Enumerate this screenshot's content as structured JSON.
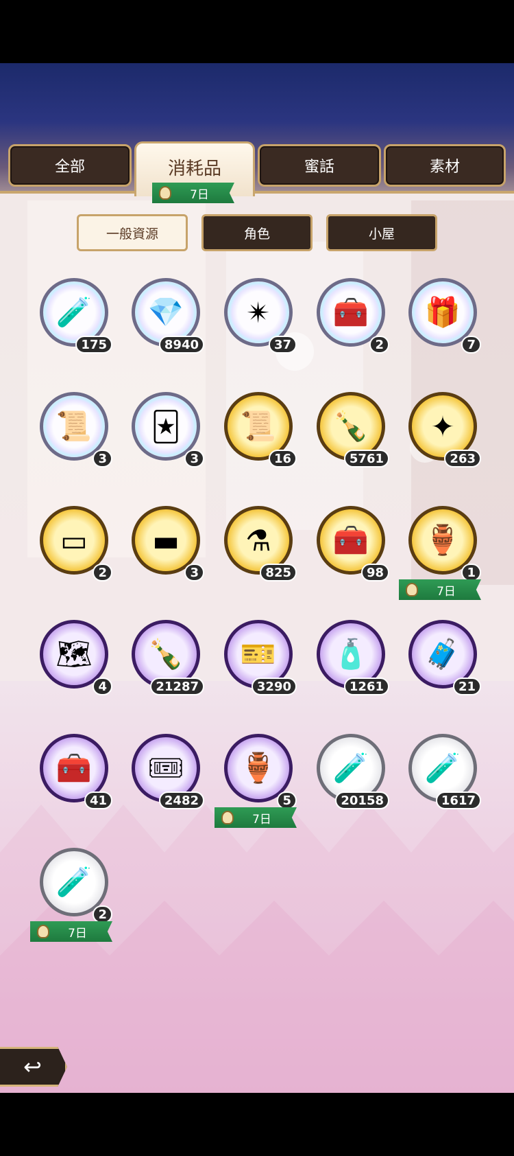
{
  "tabs": [
    {
      "label": "全部"
    },
    {
      "label": "消耗品"
    },
    {
      "label": "蜜話"
    },
    {
      "label": "素材"
    }
  ],
  "tab_timer": "7日",
  "subtabs": [
    {
      "label": "一般資源"
    },
    {
      "label": "角色"
    },
    {
      "label": "小屋"
    }
  ],
  "items": [
    {
      "count": "175",
      "icon": "green-potion-icon",
      "frame": "rainbow"
    },
    {
      "count": "8940",
      "icon": "crystal-icon",
      "frame": "rainbow"
    },
    {
      "count": "37",
      "icon": "purple-star-icon",
      "frame": "rainbow"
    },
    {
      "count": "2",
      "icon": "red-chest-icon",
      "frame": "rainbow"
    },
    {
      "count": "7",
      "icon": "blue-box-icon",
      "frame": "rainbow"
    },
    {
      "count": "3",
      "icon": "scroll-feather-icon",
      "frame": "rainbow"
    },
    {
      "count": "3",
      "icon": "card-icon",
      "frame": "rainbow"
    },
    {
      "count": "16",
      "icon": "scroll-icon",
      "frame": "gold"
    },
    {
      "count": "5761",
      "icon": "green-bottle-icon",
      "frame": "gold"
    },
    {
      "count": "263",
      "icon": "red-star-icon",
      "frame": "gold"
    },
    {
      "count": "2",
      "icon": "silver-bar-icon",
      "frame": "gold"
    },
    {
      "count": "3",
      "icon": "gold-bar-icon",
      "frame": "gold"
    },
    {
      "count": "825",
      "icon": "blue-potion-icon",
      "frame": "gold"
    },
    {
      "count": "98",
      "icon": "green-chest-icon",
      "frame": "gold"
    },
    {
      "count": "1",
      "icon": "red-potion-icon",
      "frame": "gold",
      "timer": "7日"
    },
    {
      "count": "4",
      "icon": "map-scroll-icon",
      "frame": "purple"
    },
    {
      "count": "21287",
      "icon": "green-bottle-icon",
      "frame": "purple"
    },
    {
      "count": "3290",
      "icon": "ticket-icon",
      "frame": "purple"
    },
    {
      "count": "1261",
      "icon": "blue-bottle-icon",
      "frame": "purple"
    },
    {
      "count": "21",
      "icon": "brown-chest-icon",
      "frame": "purple"
    },
    {
      "count": "41",
      "icon": "green-chest-icon",
      "frame": "purple"
    },
    {
      "count": "2482",
      "icon": "green-ticket-icon",
      "frame": "purple"
    },
    {
      "count": "5",
      "icon": "red-potion-icon",
      "frame": "purple",
      "timer": "7日"
    },
    {
      "count": "20158",
      "icon": "green-vial-icon",
      "frame": "silver"
    },
    {
      "count": "1617",
      "icon": "blue-vial-icon",
      "frame": "silver"
    },
    {
      "count": "2",
      "icon": "red-vial-icon",
      "frame": "silver",
      "timer": "7日"
    }
  ],
  "back_icon": "back-arrow-icon"
}
